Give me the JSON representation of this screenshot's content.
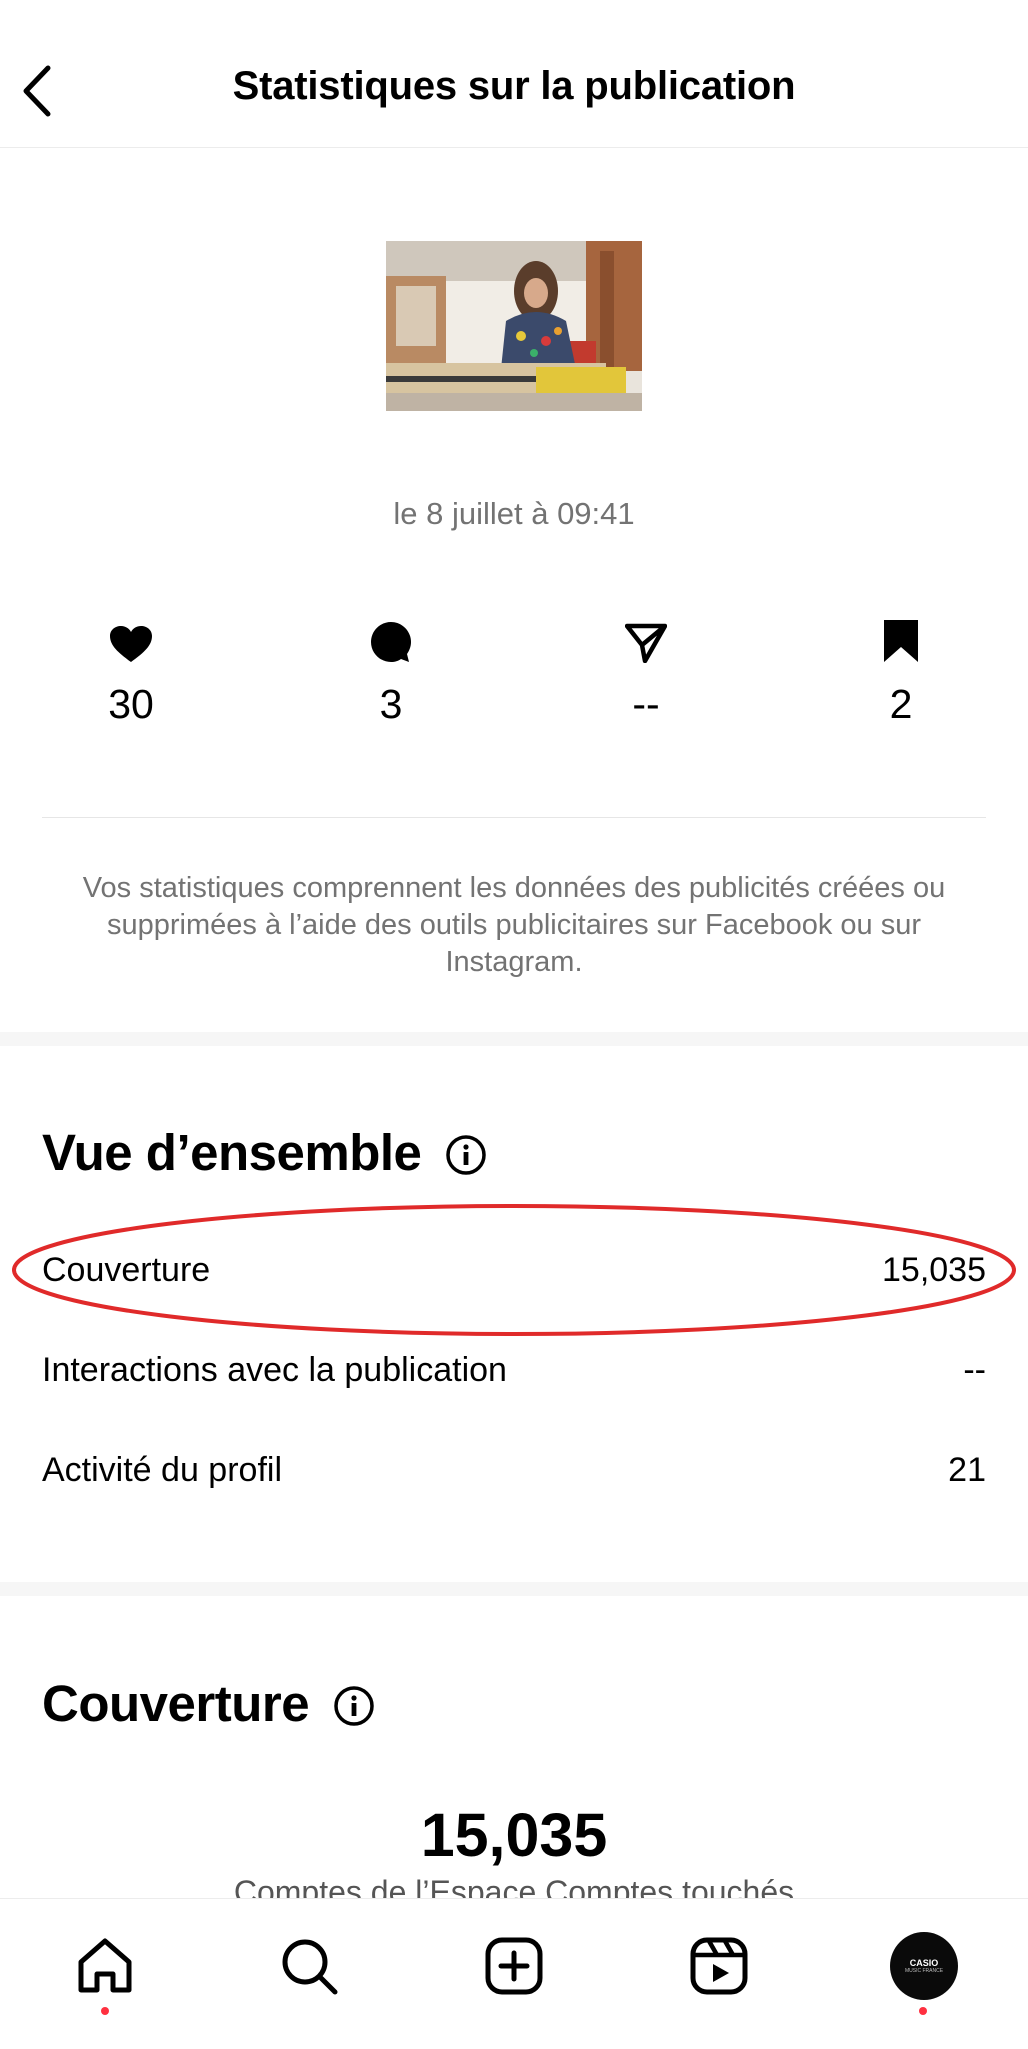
{
  "header": {
    "title": "Statistiques sur la publication"
  },
  "post": {
    "date": "le 8 juillet à 09:41"
  },
  "metrics": [
    {
      "icon": "heart-icon",
      "value": "30"
    },
    {
      "icon": "comment-icon",
      "value": "3"
    },
    {
      "icon": "share-icon",
      "value": "--"
    },
    {
      "icon": "bookmark-icon",
      "value": "2"
    }
  ],
  "disclaimer": "Vos statistiques comprennent les données des publicités créées ou supprimées à l’aide des outils publicitaires sur Facebook ou sur Instagram.",
  "overview": {
    "title": "Vue d’ensemble",
    "rows": [
      {
        "label": "Couverture",
        "value": "15,035"
      },
      {
        "label": "Interactions avec la publication",
        "value": "--"
      },
      {
        "label": "Activité du profil",
        "value": "21"
      }
    ]
  },
  "reach": {
    "title": "Couverture",
    "value": "15,035",
    "label": "Comptes de l’Espace Comptes touchés"
  },
  "tabbar": {
    "tabs": [
      "home-icon",
      "search-icon",
      "create-icon",
      "reels-icon",
      "profile-avatar"
    ],
    "avatar_text": "CASIO",
    "avatar_subtext": "MUSIC FRANCE"
  },
  "colors": {
    "highlight": "#e02a2a",
    "notification_dot": "#ff3040",
    "secondary_text": "#737373"
  }
}
